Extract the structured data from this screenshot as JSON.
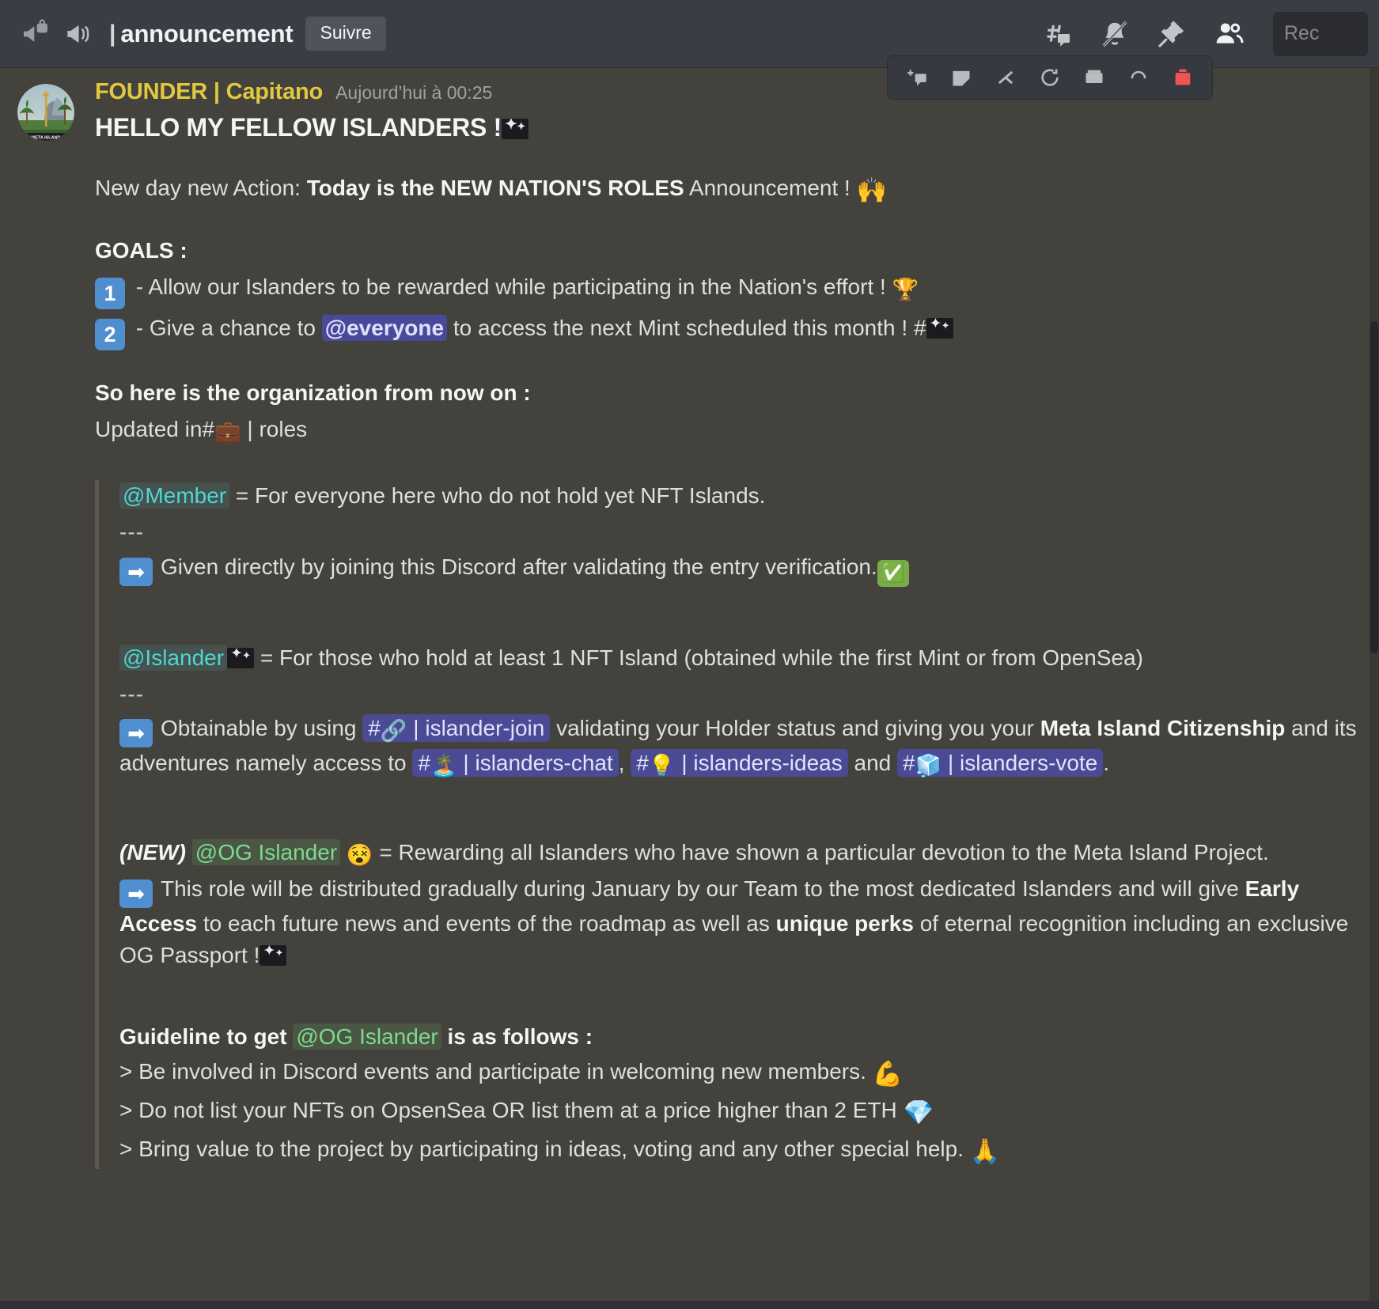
{
  "topbar": {
    "channel_name": "announcement",
    "separator": "|",
    "follow_label": "Suivre",
    "icons": [
      "megaphone-lock-icon",
      "megaphone-icon",
      "threads-icon",
      "notification-muted-icon",
      "pin-icon",
      "members-icon"
    ],
    "search_text": "Rec"
  },
  "hover_toolbar": {
    "icons": [
      "add-reaction-icon",
      "sticker-icon",
      "thread-icon",
      "clock-icon",
      "archive-icon",
      "more-icon",
      "delete-icon"
    ]
  },
  "message": {
    "author": "FOUNDER | Capitano",
    "timestamp": "Aujourd’hui à 00:25",
    "avatar_label": "META ISLAND",
    "heading": "HELLO MY FELLOW ISLANDERS !",
    "intro": {
      "lead": "New day new Action:",
      "bold": "Today is the NEW NATION'S ROLES",
      "tail": "Announcement !",
      "emoji": "🙌"
    },
    "goals": {
      "title": "GOALS :",
      "items": [
        {
          "num": "1",
          "text_before": "- Allow our Islanders to be rewarded while participating in the Nation's effort !",
          "emoji": "🏆"
        },
        {
          "num": "2",
          "text_before": "- Give a chance to",
          "mention": "@everyone",
          "text_after": "to access the next Mint scheduled this month !",
          "hash": "#"
        }
      ]
    },
    "org_title": "So here is the organization from now on :",
    "updated_line": {
      "prefix": "Updated in",
      "hash": "#",
      "emoji": "💼",
      "pipe": "|",
      "channel": "roles"
    },
    "roles": [
      {
        "name": "@Member",
        "name_color": "cyan",
        "description": "= For everyone here who do not hold yet NFT Islands.",
        "divider": "---",
        "detail_prefix": "Given directly by joining this Discord after validating the entry verification.",
        "detail_badge": "✅"
      },
      {
        "name": "@Islander",
        "name_color": "cyan",
        "description": "= For those who hold at least 1 NFT Island (obtained while the first Mint or from OpenSea)",
        "divider": "---",
        "detail_lead": "Obtainable by using",
        "channel1_hash": "#",
        "channel1_emoji": "🔗",
        "channel1_name": "islander-join",
        "detail_mid": "validating your Holder status and giving you your",
        "bold1": "Meta Island Citizenship",
        "detail_mid2": "and its adventures namely access to",
        "channel2_hash": "#",
        "channel2_emoji": "🏝️",
        "channel2_name": "islanders-chat",
        "comma": ",",
        "channel3_hash": "#",
        "channel3_emoji": "💡",
        "channel3_name": "islanders-ideas",
        "and": "and",
        "channel4_hash": "#",
        "channel4_emoji": "🧊",
        "channel4_name": "islanders-vote",
        "period": "."
      },
      {
        "new_tag": "(NEW)",
        "name": "@OG Islander",
        "name_color": "green",
        "badge_emoji": "😵",
        "description": "= Rewarding all Islanders who have shown a particular devotion to the Meta Island Project.",
        "detail_line1": "This role will be distributed gradually during January by our Team to the most dedicated Islanders and will give",
        "bold1": "Early Access",
        "detail_line2": "to each future news and events of the roadmap as well as",
        "bold2": "unique perks",
        "detail_line3": "of eternal recognition including an exclusive OG Passport !"
      }
    ],
    "guideline": {
      "prefix": "Guideline to get",
      "role": "@OG Islander",
      "suffix": "is as follows :",
      "lines": [
        {
          "text": "> Be involved in Discord events and participate in welcoming new members.",
          "emoji": "💪"
        },
        {
          "text": "> Do not list your NFTs on OpsenSea OR list them at a price higher than 2 ETH",
          "emoji": "💎"
        },
        {
          "text": "> Bring value to the project by participating in ideas, voting and any other special help.",
          "emoji": "🙏"
        }
      ]
    }
  },
  "colors": {
    "topbar_bg": "#3a3d43",
    "chat_bg": "#44423c",
    "username": "#e0c840",
    "mention_bg": "#49499a",
    "role_cyan": "#4ed6d6",
    "role_green": "#7ddb8d",
    "channel_chip": "#4a4a95",
    "keycap_blue": "#4f8fd0"
  }
}
